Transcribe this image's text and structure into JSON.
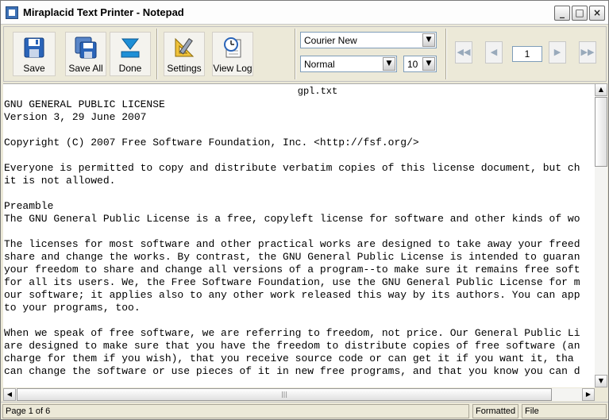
{
  "window": {
    "title": "Miraplacid Text Printer - Notepad",
    "min": "_",
    "max": "□",
    "close": "×"
  },
  "toolbar": {
    "buttons": [
      {
        "label": "Save",
        "icon": "floppy-disk-icon"
      },
      {
        "label": "Save All",
        "icon": "multiple-floppy-icon"
      },
      {
        "label": "Done",
        "icon": "download-arrow-icon"
      },
      {
        "label": "Settings",
        "icon": "ruler-triangle-icon"
      },
      {
        "label": "View Log",
        "icon": "clock-document-icon"
      }
    ],
    "font": "Courier New",
    "style": "Normal",
    "size": "10",
    "page_input": "1"
  },
  "document": {
    "title": "gpl.txt",
    "lines": [
      "GNU GENERAL PUBLIC LICENSE",
      "Version 3, 29 June 2007",
      "",
      "Copyright (C) 2007 Free Software Foundation, Inc. <http://fsf.org/>",
      "",
      "Everyone is permitted to copy and distribute verbatim copies of this license document, but ch",
      "it is not allowed.",
      "",
      "Preamble",
      "The GNU General Public License is a free, copyleft license for software and other kinds of wo",
      "",
      "The licenses for most software and other practical works are designed to take away your freed",
      "share and change the works. By contrast, the GNU General Public License is intended to guaran",
      "your freedom to share and change all versions of a program--to make sure it remains free soft",
      "for all its users. We, the Free Software Foundation, use the GNU General Public License for m",
      "our software; it applies also to any other work released this way by its authors. You can app",
      "to your programs, too.",
      "",
      "When we speak of free software, we are referring to freedom, not price. Our General Public Li",
      "are designed to make sure that you have the freedom to distribute copies of free software (an",
      "charge for them if you wish), that you receive source code or can get it if you want it, tha",
      "can change the software or use pieces of it in new free programs, and that you know you can d"
    ]
  },
  "status": {
    "page": "Page 1 of 6",
    "format": "Formatted",
    "file": "File"
  },
  "colors": {
    "accent": "#3b6fb5",
    "window_bg": "#ece9d8"
  }
}
